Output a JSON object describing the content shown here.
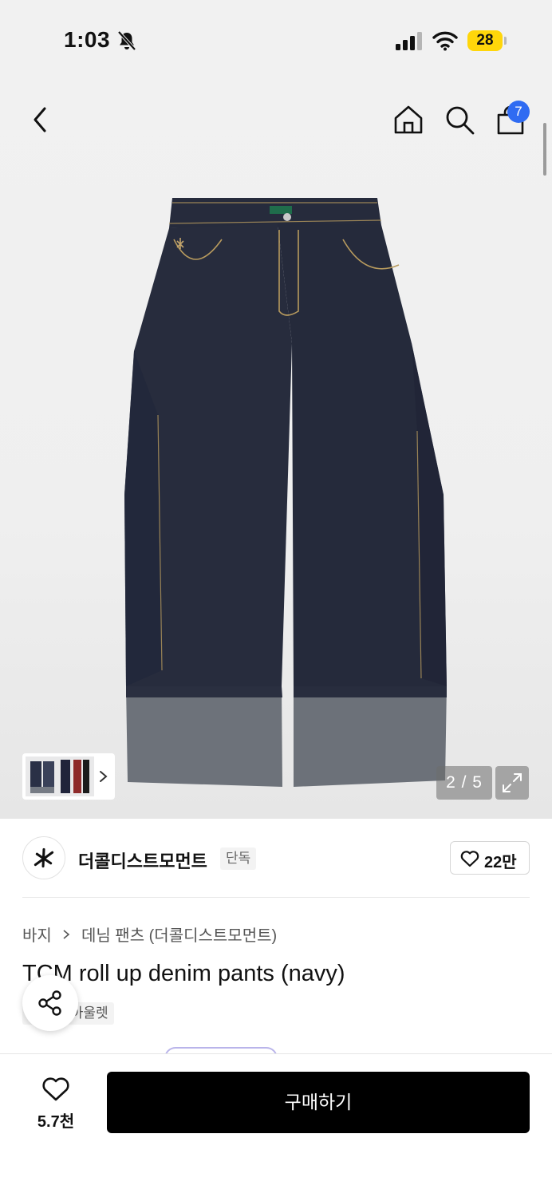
{
  "status_bar": {
    "time": "1:03",
    "battery": "28",
    "icons": [
      "bell-slash-icon",
      "cellular-signal-icon",
      "wifi-icon",
      "battery-icon"
    ]
  },
  "nav": {
    "icons": [
      "back-chevron-icon",
      "home-icon",
      "search-icon",
      "shopping-bag-icon"
    ],
    "cart_count": "7"
  },
  "gallery": {
    "counter": "2 / 5",
    "current_image": 2,
    "total_images": 5,
    "expand_icon": "expand-arrows-icon"
  },
  "brand": {
    "name": "더콜디스트모먼트",
    "tag": "단독",
    "likes": "22만"
  },
  "breadcrumb": {
    "category": "바지",
    "subcategory": "데님 팬츠 (더콜디스트모먼트)"
  },
  "product": {
    "title": "TCM roll up denim pants (navy)",
    "tags": [
      "단독",
      "아울렛"
    ]
  },
  "bottom_bar": {
    "wish_count": "5.7천",
    "buy_label": "구매하기"
  },
  "colors": {
    "badge": "#2f6bf2",
    "battery": "#ffd60a",
    "buy_button": "#000000",
    "denim": "#262b3c",
    "cuff": "#6d727a"
  }
}
